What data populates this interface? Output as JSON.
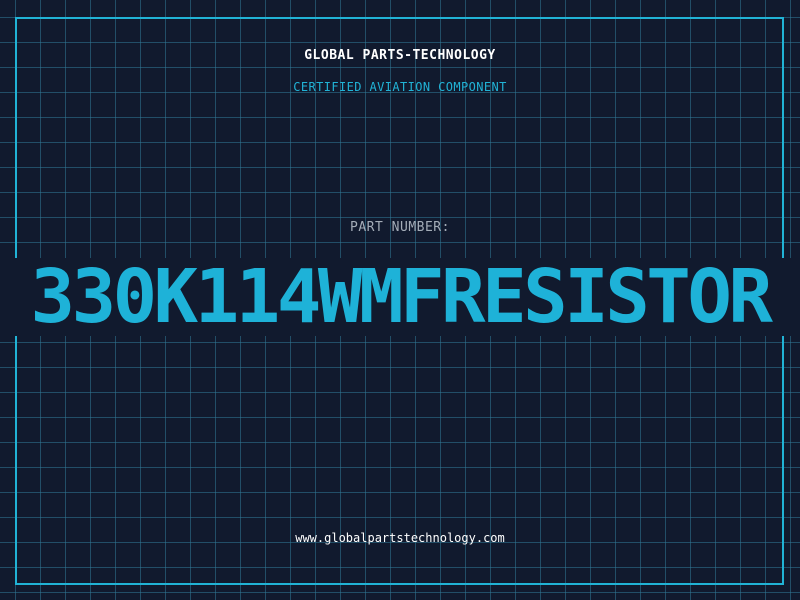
{
  "header": {
    "company": "GLOBAL PARTS-TECHNOLOGY",
    "tagline": "CERTIFIED AVIATION COMPONENT"
  },
  "part": {
    "label": "PART NUMBER:",
    "number": "330K114WMFRESISTOR"
  },
  "footer": {
    "website": "www.globalpartstechnology.com"
  },
  "colors": {
    "background": "#111a2e",
    "accent": "#1eb2d8",
    "grid": "#307896",
    "label": "#a4adb8",
    "text": "#ffffff"
  }
}
